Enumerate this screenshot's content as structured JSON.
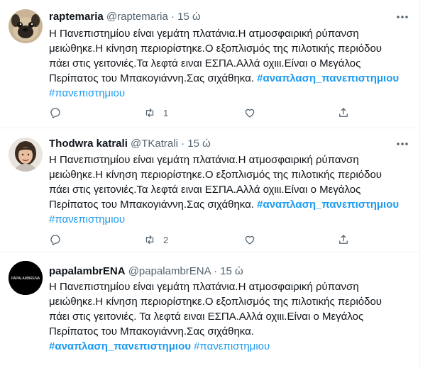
{
  "tweets": [
    {
      "name": "raptemaria",
      "handle": "@raptemaria",
      "time": "15 ώ",
      "text": "Η Πανεπιστημίου είναι γεμάτη πλατάνια.Η ατμοσφαιρική ρύπανση\nμειώθηκε.Η κίνηση περιορίστηκε.Ο εξοπλισμός της πιλοτικής περιόδου\nπάει στις γειτονιές.Τα λεφτά ειναι ΕΣΠΑ.Αλλά οχιιι.Είναι ο Μεγάλος\nΠερίπατος του Μπακογιάννη.Σας σιχάθηκα.",
      "hashtag1": "#αναπλαση_πανεπιστημιου",
      "hashtag2": "#πανεπιστημιου",
      "replies": "",
      "retweets": "1",
      "likes": ""
    },
    {
      "name": "Thodwra katrali",
      "handle": "@TKatrali",
      "time": "15 ώ",
      "text": "Η Πανεπιστημίου είναι γεμάτη πλατάνια.Η ατμοσφαιρική ρύπανση\nμειώθηκε.Η κίνηση περιορίστηκε.Ο εξοπλισμός της πιλοτικής περιόδου\nπάει στις γειτονιές.Τα λεφτά ειναι ΕΣΠΑ.Αλλά οχιιι.Είναι ο Μεγάλος\nΠερίπατος του Μπακογιάννη.Σας σιχάθηκα.",
      "hashtag1": "#αναπλαση_πανεπιστημιου",
      "hashtag2": "#πανεπιστημιου",
      "replies": "",
      "retweets": "2",
      "likes": ""
    },
    {
      "name": "papalambrENA",
      "handle": "@papalambrENA",
      "time": "15 ώ",
      "avatar_text": "PAPALAMBRENA",
      "text": "Η Πανεπιστημίου είναι γεμάτη πλατάνια.Η ατμοσφαιρική ρύπανση\nμειώθηκε.Η κίνηση περιορίστηκε.Ο εξοπλισμός της πιλοτικής περιόδου\nπάει στις γειτονιές. Τα λεφτά ειναι ΕΣΠΑ.Αλλά οχιιι.Είναι ο Μεγάλος\nΠερίπατος του Μπακογιάννη.Σας σιχάθηκα.",
      "hashtag1": "#αναπλαση_πανεπιστημιου",
      "hashtag2": "#πανεπιστημιου"
    }
  ],
  "separator_dot": "·",
  "colors": {
    "link": "#1d9bf0",
    "muted": "#536471",
    "text": "#0f1419",
    "border": "#eff3f4"
  },
  "icons": [
    "reply-icon",
    "retweet-icon",
    "like-icon",
    "share-icon",
    "more-icon"
  ]
}
